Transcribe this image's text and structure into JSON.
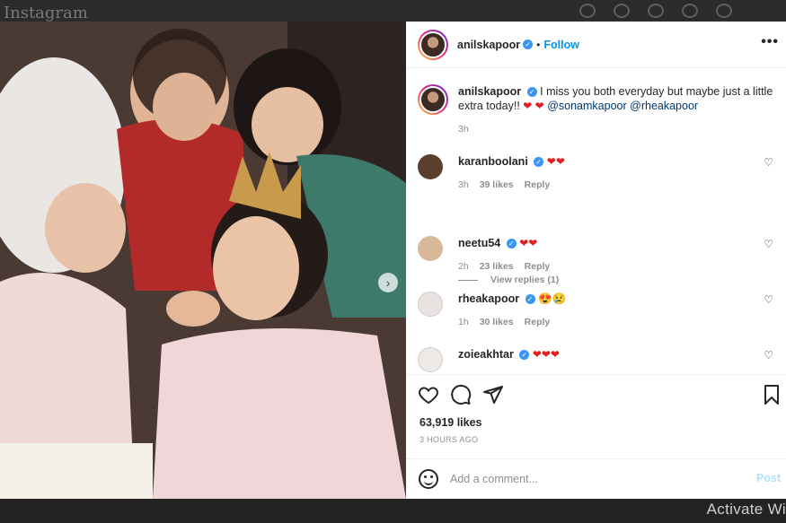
{
  "background": {
    "logo_text": "Instagram"
  },
  "watermark": {
    "text": "Activate Wi"
  },
  "post": {
    "author": "anilskapoor",
    "follow_label": "Follow",
    "more_label": "•••",
    "caption": {
      "text_before": "I miss you both everyday but maybe just a little extra today!!",
      "hearts": "❤ ❤",
      "mention1": "@sonamkapoor",
      "mention2": "@rheakapoor",
      "time": "3h"
    },
    "comments": [
      {
        "user": "karanboolani",
        "text": "❤❤",
        "time": "3h",
        "likes": "39 likes",
        "reply": "Reply"
      },
      {
        "user": "neetu54",
        "text": "❤❤",
        "time": "2h",
        "likes": "23 likes",
        "reply": "Reply"
      },
      {
        "user": "rheakapoor",
        "text": "😍😢",
        "time": "1h",
        "likes": "30 likes",
        "reply": "Reply"
      },
      {
        "user": "zoieakhtar",
        "text": "❤❤❤"
      }
    ],
    "view_replies": "View replies (1)",
    "likes_count": "63,919 likes",
    "posted_ago": "3 HOURS AGO",
    "comment_placeholder": "Add a comment...",
    "post_label": "Post"
  },
  "colors": {
    "accent": "#0095f6",
    "verified": "#3897f0",
    "heart": "#e02020"
  }
}
